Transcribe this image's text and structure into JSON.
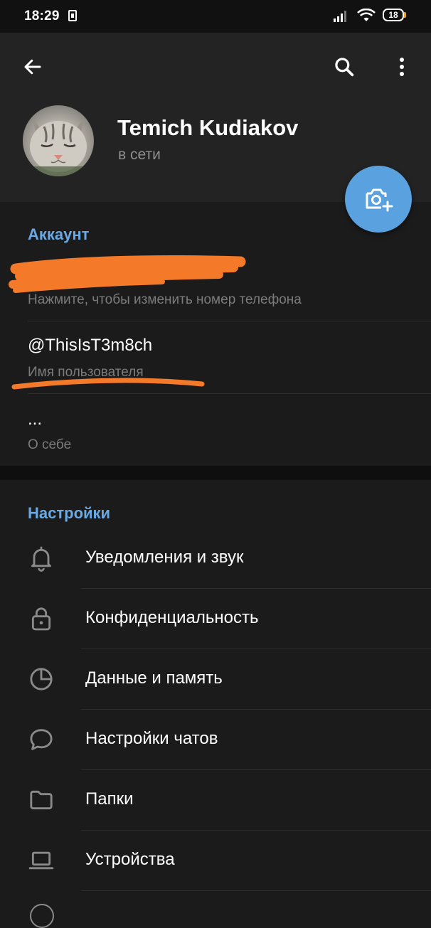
{
  "status_bar": {
    "time": "18:29",
    "battery": "18"
  },
  "toolbar": {
    "back_icon": "arrow-left-icon",
    "search_icon": "search-icon",
    "more_icon": "more-vertical-icon"
  },
  "profile": {
    "name": "Temich Kudiakov",
    "status": "в сети",
    "set_photo_icon": "camera-add-icon"
  },
  "account": {
    "title": "Аккаунт",
    "phone_hint": "Нажмите, чтобы изменить номер телефона",
    "username_value": "@ThisIsT3m8ch",
    "username_label": "Имя пользователя",
    "bio_value": "...",
    "bio_label": "О себе"
  },
  "settings": {
    "title": "Настройки",
    "items": [
      {
        "label": "Уведомления и звук",
        "icon": "bell-icon"
      },
      {
        "label": "Конфиденциальность",
        "icon": "lock-icon"
      },
      {
        "label": "Данные и память",
        "icon": "pie-chart-icon"
      },
      {
        "label": "Настройки чатов",
        "icon": "chat-bubble-icon"
      },
      {
        "label": "Папки",
        "icon": "folder-icon"
      },
      {
        "label": "Устройства",
        "icon": "laptop-icon"
      }
    ]
  },
  "colors": {
    "accent": "#6aa9e3",
    "fab": "#5aa2df",
    "scribble": "#f47a2a",
    "background": "#1b1b1b",
    "header": "#232323"
  }
}
